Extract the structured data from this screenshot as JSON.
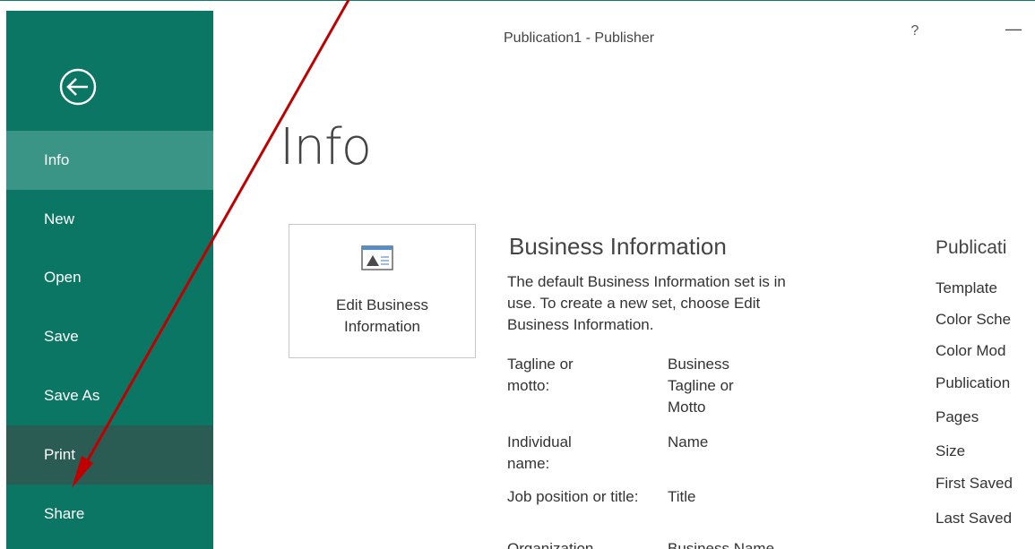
{
  "window": {
    "title": "Publication1 - Publisher",
    "help_label": "?",
    "minimize_label": "—"
  },
  "sidebar": {
    "back_label": "Back",
    "items": [
      {
        "label": "Info",
        "state": "selected"
      },
      {
        "label": "New"
      },
      {
        "label": "Open"
      },
      {
        "label": "Save"
      },
      {
        "label": "Save As"
      },
      {
        "label": "Print",
        "state": "hovered"
      },
      {
        "label": "Share"
      }
    ]
  },
  "page": {
    "title": "Info"
  },
  "edit_tile": {
    "line1": "Edit Business",
    "line2": "Information"
  },
  "business_info": {
    "title": "Business Information",
    "description": "The default Business Information set is in use. To create a new set, choose Edit Business Information.",
    "fields": [
      {
        "label": "Tagline or motto:",
        "value": "Business Tagline or Motto"
      },
      {
        "label": "Individual name:",
        "value": "Name"
      },
      {
        "label": "Job position or title:",
        "value": "Title"
      },
      {
        "label": "Organization",
        "value": "Business Name"
      }
    ]
  },
  "publication": {
    "title": "Publicati",
    "properties": [
      "Template",
      "Color Sche",
      "Color Mod",
      "Publication",
      "Pages",
      "Size",
      "First Saved",
      "Last Saved"
    ]
  },
  "colors": {
    "sidebar": "#0c7665",
    "selected": "#3a9586",
    "hovered": "#2a5c54",
    "annotation_arrow": "#c00000"
  }
}
